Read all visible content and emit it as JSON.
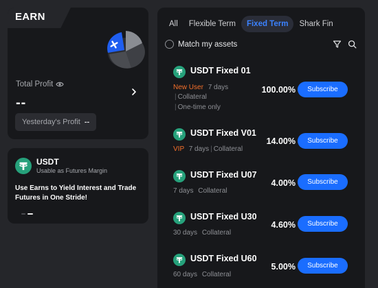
{
  "left": {
    "earn_title": "EARN",
    "total_profit_label": "Total Profit",
    "total_profit_value": "--",
    "yesterday_label": "Yesterday's Profit",
    "yesterday_value": "--",
    "usdt_card": {
      "name": "USDT",
      "subtitle": "Usable as Futures Margin",
      "description": "Use Earns to Yield Interest and Trade Futures in One Stride!"
    }
  },
  "tabs": [
    "All",
    "Flexible Term",
    "Fixed Term",
    "Shark Fin"
  ],
  "active_tab": "Fixed Term",
  "match_assets_label": "Match my assets",
  "products": [
    {
      "name": "USDT Fixed 01",
      "tag": "New User",
      "days": "7 days",
      "lines": [
        "Collateral",
        "One-time only"
      ],
      "rate": "100.00%",
      "button": "Subscribe"
    },
    {
      "name": "USDT Fixed V01",
      "tag": "VIP",
      "days": "7 days",
      "collateral": "Collateral",
      "rate": "14.00%",
      "button": "Subscribe"
    },
    {
      "name": "USDT Fixed U07",
      "days": "7 days",
      "collateral": "Collateral",
      "rate": "4.00%",
      "button": "Subscribe"
    },
    {
      "name": "USDT Fixed U30",
      "days": "30 days",
      "collateral": "Collateral",
      "rate": "4.60%",
      "button": "Subscribe"
    },
    {
      "name": "USDT Fixed U60",
      "days": "60 days",
      "collateral": "Collateral",
      "rate": "5.00%",
      "button": "Subscribe"
    }
  ],
  "colors": {
    "background": "#25262a",
    "card": "#17181b",
    "accent_blue": "#1a6dff",
    "tag_orange": "#f5702a",
    "usdt_green": "#26a17b"
  }
}
